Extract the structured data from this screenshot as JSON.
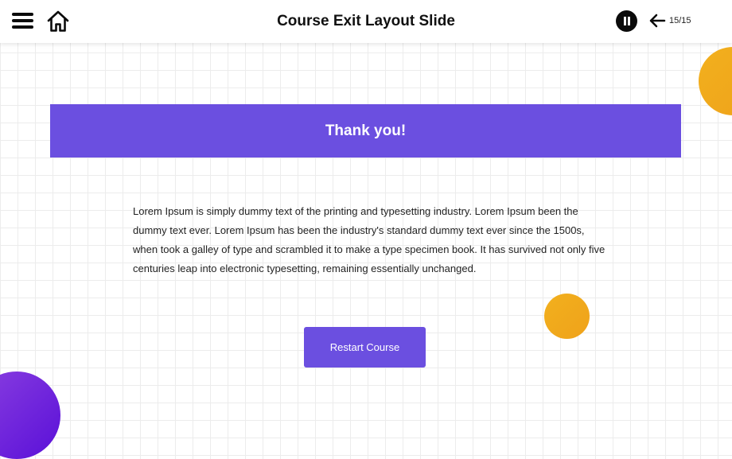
{
  "header": {
    "title": "Course Exit Layout Slide",
    "page_counter": "15/15",
    "icons": {
      "menu": "menu-icon",
      "home": "home-icon",
      "pause": "pause-icon",
      "back": "arrow-left-icon"
    }
  },
  "banner": {
    "title": "Thank you!"
  },
  "content": {
    "paragraph": "Lorem Ipsum is simply dummy text of the printing and typesetting industry. Lorem Ipsum been the dummy text ever. Lorem Ipsum has been the industry's standard dummy text ever since the 1500s, when took a galley of type and scrambled it to make a type specimen book. It has survived not only five centuries leap into electronic typesetting, remaining essentially unchanged."
  },
  "actions": {
    "restart_label": "Restart Course"
  },
  "colors": {
    "accent": "#6b4fe0",
    "gold": "#f2b01e",
    "gold_dark": "#efa21a",
    "purple_dark": "#5a10d8",
    "purple_light": "#8a3fe0",
    "text": "#222222"
  }
}
